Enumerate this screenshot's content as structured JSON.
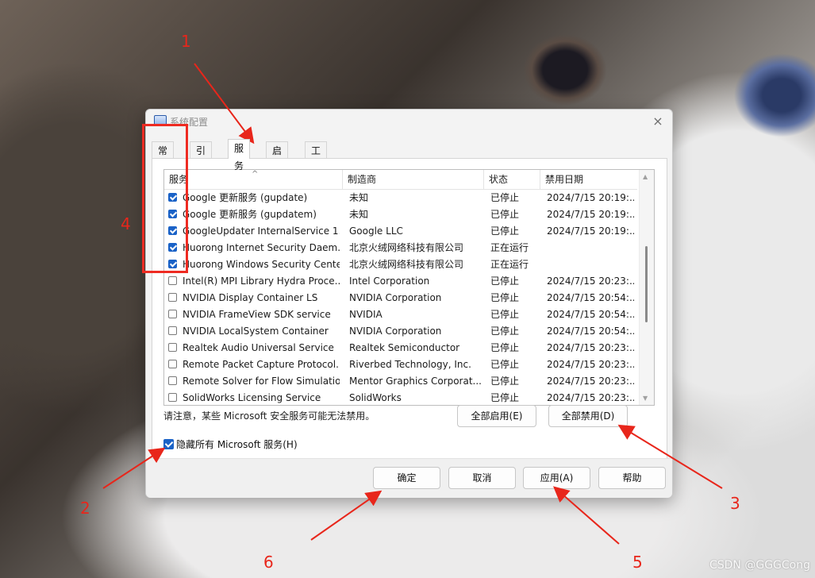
{
  "window": {
    "title": "系统配置",
    "close_glyph": "×"
  },
  "tabs": [
    {
      "label": "常规"
    },
    {
      "label": "引导"
    },
    {
      "label": "服务",
      "active": true
    },
    {
      "label": "启动"
    },
    {
      "label": "工具"
    }
  ],
  "table": {
    "sort_glyph": "^",
    "columns": [
      "服务",
      "制造商",
      "状态",
      "禁用日期"
    ],
    "rows": [
      {
        "checked": true,
        "service": "Google 更新服务 (gupdate)",
        "vendor": "未知",
        "status": "已停止",
        "date": "2024/7/15 20:19:..."
      },
      {
        "checked": true,
        "service": "Google 更新服务 (gupdatem)",
        "vendor": "未知",
        "status": "已停止",
        "date": "2024/7/15 20:19:..."
      },
      {
        "checked": true,
        "service": "GoogleUpdater InternalService 1...",
        "vendor": "Google LLC",
        "status": "已停止",
        "date": "2024/7/15 20:19:..."
      },
      {
        "checked": true,
        "service": "Huorong Internet Security Daem...",
        "vendor": "北京火绒网络科技有限公司",
        "status": "正在运行",
        "date": ""
      },
      {
        "checked": true,
        "service": "Huorong Windows Security Center",
        "vendor": "北京火绒网络科技有限公司",
        "status": "正在运行",
        "date": ""
      },
      {
        "checked": false,
        "service": "Intel(R) MPI Library Hydra Proce...",
        "vendor": "Intel Corporation",
        "status": "已停止",
        "date": "2024/7/15 20:23:..."
      },
      {
        "checked": false,
        "service": "NVIDIA Display Container LS",
        "vendor": "NVIDIA Corporation",
        "status": "已停止",
        "date": "2024/7/15 20:54:..."
      },
      {
        "checked": false,
        "service": "NVIDIA FrameView SDK service",
        "vendor": "NVIDIA",
        "status": "已停止",
        "date": "2024/7/15 20:54:..."
      },
      {
        "checked": false,
        "service": "NVIDIA LocalSystem Container",
        "vendor": "NVIDIA Corporation",
        "status": "已停止",
        "date": "2024/7/15 20:54:..."
      },
      {
        "checked": false,
        "service": "Realtek Audio Universal Service",
        "vendor": "Realtek Semiconductor",
        "status": "已停止",
        "date": "2024/7/15 20:23:..."
      },
      {
        "checked": false,
        "service": "Remote Packet Capture Protocol...",
        "vendor": "Riverbed Technology, Inc.",
        "status": "已停止",
        "date": "2024/7/15 20:23:..."
      },
      {
        "checked": false,
        "service": "Remote Solver for Flow Simulatio...",
        "vendor": "Mentor Graphics Corporat...",
        "status": "已停止",
        "date": "2024/7/15 20:23:..."
      },
      {
        "checked": false,
        "service": "SolidWorks Licensing Service",
        "vendor": "SolidWorks",
        "status": "已停止",
        "date": "2024/7/15 20:23:..."
      }
    ]
  },
  "note": "请注意，某些 Microsoft 安全服务可能无法禁用。",
  "buttons": {
    "enable_all": "全部启用(E)",
    "disable_all": "全部禁用(D)",
    "ok": "确定",
    "cancel": "取消",
    "apply": "应用(A)",
    "help": "帮助"
  },
  "hide_ms": {
    "label": "隐藏所有 Microsoft 服务(H)",
    "checked": true
  },
  "annotations": [
    "1",
    "2",
    "3",
    "4",
    "5",
    "6"
  ],
  "watermark": "CSDN @GGGCong",
  "colors": {
    "annotation": "#e8261b",
    "checkbox": "#1a62c7"
  }
}
